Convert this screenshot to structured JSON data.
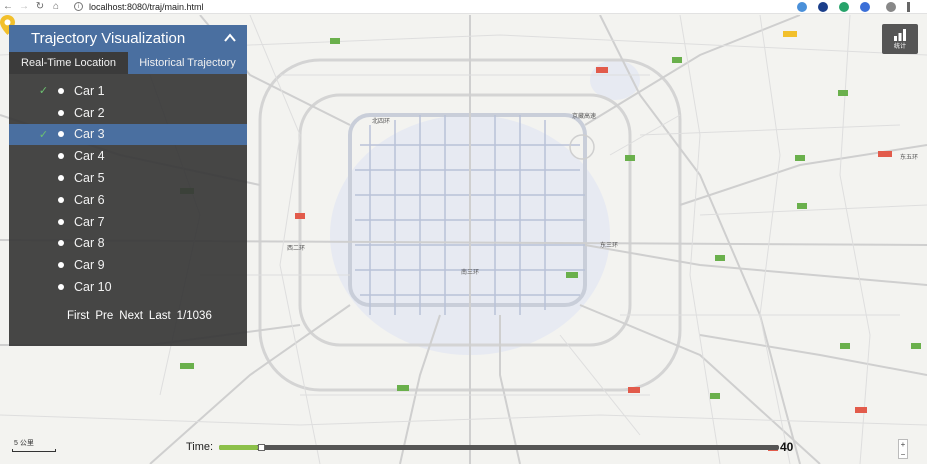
{
  "browser": {
    "url": "localhost:8080/traj/main.html"
  },
  "panel": {
    "title": "Trajectory Visualization",
    "tabs": [
      {
        "label": "Real-Time Location"
      },
      {
        "label": "Historical Trajectory"
      }
    ],
    "cars": [
      {
        "label": "Car 1",
        "checked": true
      },
      {
        "label": "Car 2",
        "checked": false
      },
      {
        "label": "Car 3",
        "checked": true
      },
      {
        "label": "Car 4",
        "checked": false
      },
      {
        "label": "Car 5",
        "checked": false
      },
      {
        "label": "Car 6",
        "checked": false
      },
      {
        "label": "Car 7",
        "checked": false
      },
      {
        "label": "Car 8",
        "checked": false
      },
      {
        "label": "Car 9",
        "checked": false
      },
      {
        "label": "Car 10",
        "checked": false
      }
    ],
    "pager": {
      "first": "First",
      "pre": "Pre",
      "next": "Next",
      "last": "Last",
      "page": "1/1036"
    }
  },
  "timeline": {
    "label": "Time:",
    "value": "40",
    "progress": 0.07
  },
  "map": {
    "scale_label": "5 公里",
    "stats_label": "统计",
    "zoom_in": "+",
    "zoom_out": "−",
    "place_labels": [
      "北四环",
      "东三环",
      "西二环",
      "南三环",
      "东五环",
      "京藏高速"
    ]
  },
  "colors": {
    "panel_bg": "#383838",
    "accent": "#4a6fa0",
    "progress": "#8cc04a",
    "pin": "#f2c02c"
  }
}
